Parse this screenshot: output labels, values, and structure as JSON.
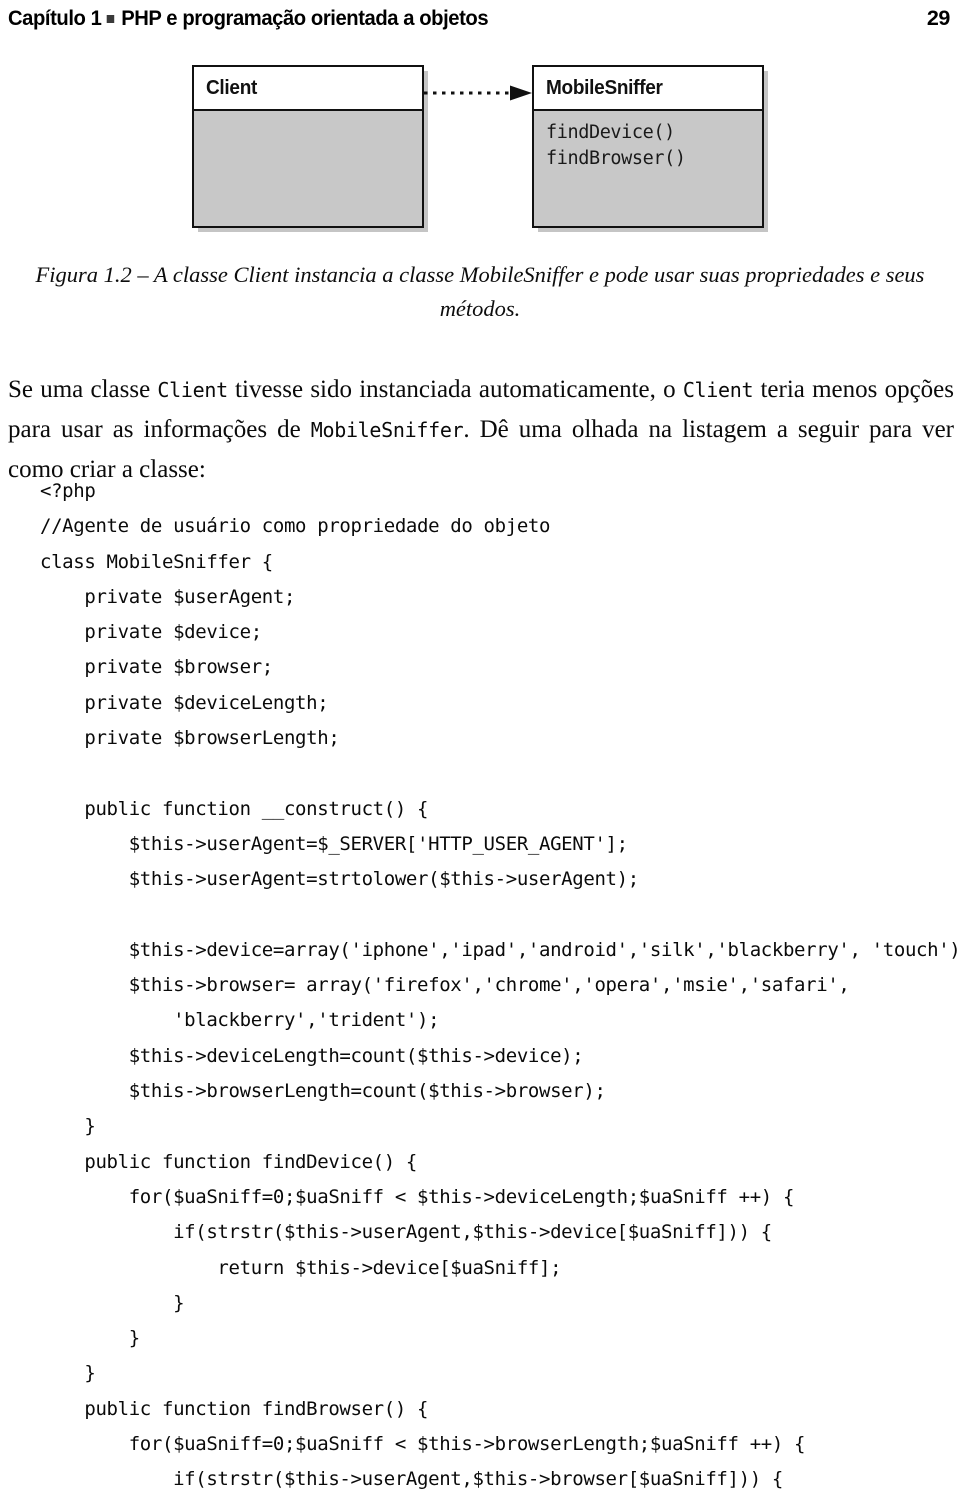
{
  "header": {
    "chapter_text": "Capítulo 1",
    "bullet": "square-bullet",
    "title_text": "PHP e programação orientada a objetos",
    "page_number": "29"
  },
  "figure": {
    "caption": "Figura 1.2 – A classe Client instancia a classe MobileSniffer e pode usar suas propriedades e seus métodos.",
    "boxes": [
      {
        "name": "Client",
        "methods": []
      },
      {
        "name": "MobileSniffer",
        "methods": [
          "findDevice()",
          "findBrowser()"
        ]
      }
    ],
    "connector": {
      "type": "dependency-dashed-arrow",
      "direction": "Client -> MobileSniffer"
    },
    "colors": {
      "box_fill": "#c8c8c8",
      "title_fill": "#ffffff",
      "border": "#111111"
    }
  },
  "body": {
    "paragraph_parts": [
      {
        "text": "Se uma classe ",
        "code": false
      },
      {
        "text": "Client",
        "code": true
      },
      {
        "text": " tivesse sido instanciada automaticamente, o ",
        "code": false
      },
      {
        "text": "Client",
        "code": true
      },
      {
        "text": " teria menos opções para usar as informações de ",
        "code": false
      },
      {
        "text": "MobileSniffer",
        "code": true
      },
      {
        "text": ". Dê uma olhada na listagem a seguir para ver como criar a classe:",
        "code": false
      }
    ]
  },
  "code": {
    "language": "php",
    "lines": [
      "<?php",
      "//Agente de usuário como propriedade do objeto",
      "class MobileSniffer {",
      "    private $userAgent;",
      "    private $device;",
      "    private $browser;",
      "    private $deviceLength;",
      "    private $browserLength;",
      "",
      "    public function __construct() {",
      "        $this->userAgent=$_SERVER['HTTP_USER_AGENT'];",
      "        $this->userAgent=strtolower($this->userAgent);",
      "",
      "        $this->device=array('iphone','ipad','android','silk','blackberry', 'touch');",
      "        $this->browser= array('firefox','chrome','opera','msie','safari',",
      "            'blackberry','trident');",
      "        $this->deviceLength=count($this->device);",
      "        $this->browserLength=count($this->browser);",
      "    }",
      "    public function findDevice() {",
      "        for($uaSniff=0;$uaSniff < $this->deviceLength;$uaSniff ++) {",
      "            if(strstr($this->userAgent,$this->device[$uaSniff])) {",
      "                return $this->device[$uaSniff];",
      "            }",
      "        }",
      "    }",
      "    public function findBrowser() {",
      "        for($uaSniff=0;$uaSniff < $this->browserLength;$uaSniff ++) {",
      "            if(strstr($this->userAgent,$this->browser[$uaSniff])) {"
    ]
  }
}
